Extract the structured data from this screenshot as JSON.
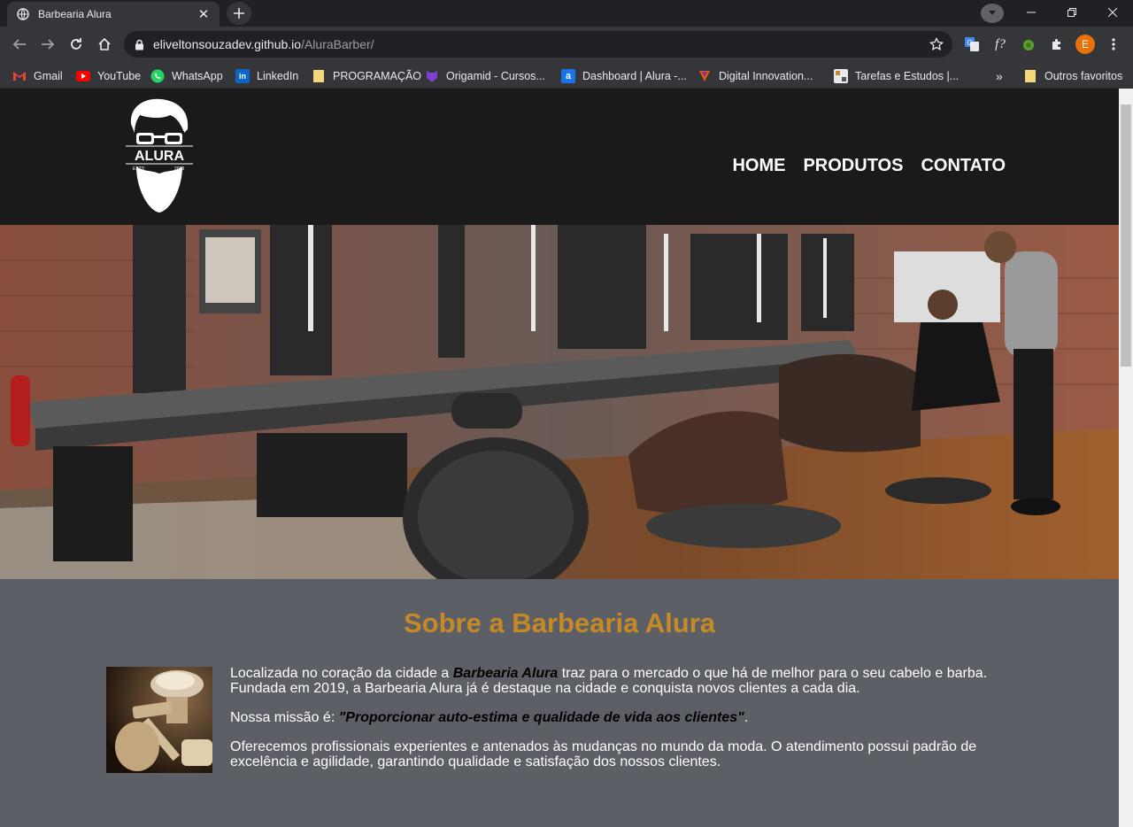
{
  "browser": {
    "tab_title": "Barbearia Alura",
    "url_host": "eliveltonsouzadev.github.io",
    "url_path": "/AluraBarber/",
    "profile_initial": "E",
    "bookmarks": [
      {
        "label": "Gmail",
        "icon": "gmail-icon"
      },
      {
        "label": "YouTube",
        "icon": "youtube-icon"
      },
      {
        "label": "WhatsApp",
        "icon": "whatsapp-icon"
      },
      {
        "label": "LinkedIn",
        "icon": "linkedin-icon"
      },
      {
        "label": "PROGRAMAÇÃO",
        "icon": "folder-icon"
      },
      {
        "label": "Origamid - Cursos...",
        "icon": "origamid-icon"
      },
      {
        "label": "Dashboard | Alura -...",
        "icon": "alura-icon"
      },
      {
        "label": "Digital Innovation...",
        "icon": "dio-icon"
      },
      {
        "label": "Tarefas e Estudos |...",
        "icon": "notion-icon"
      }
    ],
    "other_bookmarks": "Outros favoritos"
  },
  "site": {
    "logo_text": "ALURA",
    "logo_left": "ESTD",
    "logo_right": "2019",
    "nav": [
      "HOME",
      "PRODUTOS",
      "CONTATO"
    ],
    "about": {
      "heading": "Sobre a Barbearia Alura",
      "p1_before": "Localizada no coração da cidade a ",
      "p1_em": "Barbearia Alura",
      "p1_after": " traz para o mercado o que há de melhor para o seu cabelo e barba. Fundada em 2019, a Barbearia Alura já é destaque na cidade e conquista novos clientes a cada dia.",
      "p2_before": "Nossa missão é: ",
      "p2_em": "\"Proporcionar auto-estima e qualidade de vida aos clientes\"",
      "p2_after": ".",
      "p3": "Oferecemos profissionais experientes e antenados às mudanças no mundo da moda. O atendimento possui padrão de excelência e agilidade, garantindo qualidade e satisfação dos nossos clientes."
    }
  }
}
